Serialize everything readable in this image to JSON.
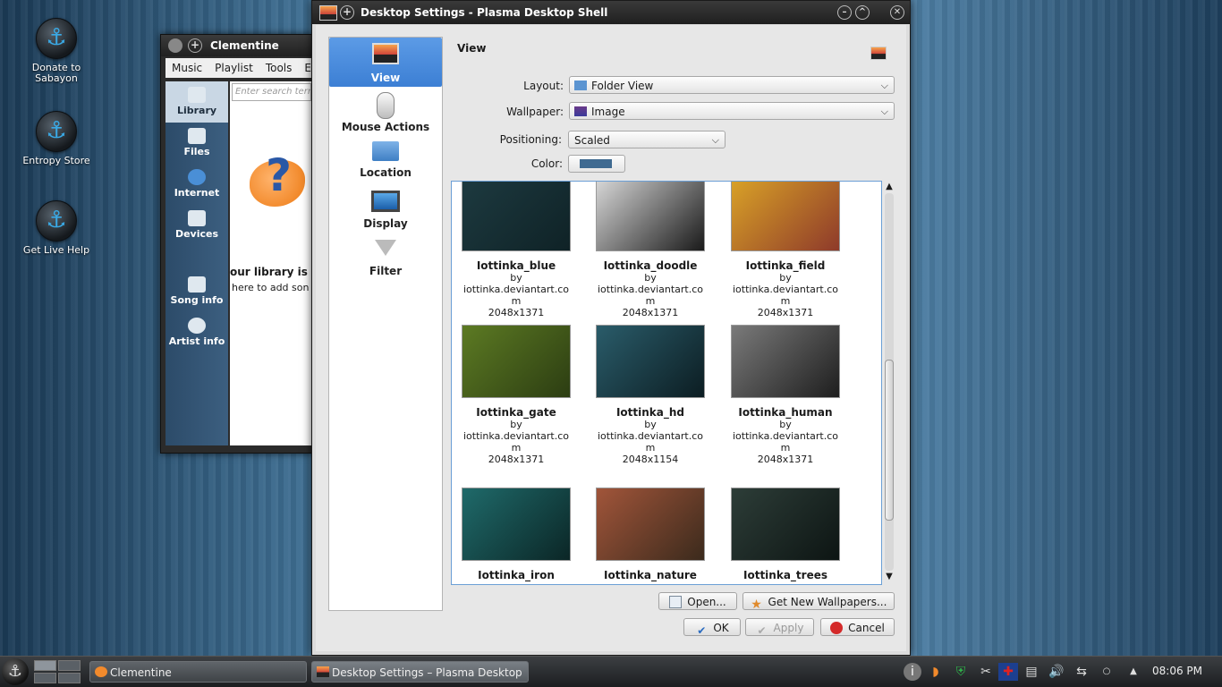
{
  "desktop": {
    "icons": [
      {
        "label_line1": "Donate to",
        "label_line2": "Sabayon"
      },
      {
        "label_line1": "Entropy Store",
        "label_line2": ""
      },
      {
        "label_line1": "Get Live Help",
        "label_line2": ""
      }
    ]
  },
  "clementine": {
    "title": "Clementine",
    "menu": [
      "Music",
      "Playlist",
      "Tools",
      "E"
    ],
    "sidebar": [
      "Library",
      "Files",
      "Internet",
      "Devices",
      "Song info",
      "Artist info"
    ],
    "search_placeholder": "Enter search terms",
    "empty_line1": "our library is en",
    "empty_line2": "here to add son"
  },
  "dialog": {
    "title": "Desktop Settings - Plasma Desktop Shell",
    "pages": [
      "View",
      "Mouse Actions",
      "Location",
      "Display",
      "Filter"
    ],
    "pane_title": "View",
    "layout_label": "Layout:",
    "layout_value": "Folder View",
    "wallpaper_label": "Wallpaper:",
    "wallpaper_value": "Image",
    "positioning_label": "Positioning:",
    "positioning_value": "Scaled",
    "color_label": "Color:",
    "color_value": "#3f6a91",
    "wallpapers": [
      {
        "name": "Iottinka_blue",
        "by": "by",
        "author": "iottinka.deviantart.co",
        "author2": "m",
        "size": "2048x1371",
        "colors": [
          "#1d3a40",
          "#0f2226"
        ]
      },
      {
        "name": "Iottinka_doodle",
        "by": "by",
        "author": "iottinka.deviantart.co",
        "author2": "m",
        "size": "2048x1371",
        "colors": [
          "#d8d8d8",
          "#1a1a1a"
        ]
      },
      {
        "name": "Iottinka_field",
        "by": "by",
        "author": "iottinka.deviantart.co",
        "author2": "m",
        "size": "2048x1371",
        "colors": [
          "#d9a227",
          "#8e3a2a"
        ]
      },
      {
        "name": "Iottinka_gate",
        "by": "by",
        "author": "iottinka.deviantart.co",
        "author2": "m",
        "size": "2048x1371",
        "colors": [
          "#5c7a23",
          "#2c3d12"
        ]
      },
      {
        "name": "Iottinka_hd",
        "by": "by",
        "author": "iottinka.deviantart.co",
        "author2": "m",
        "size": "2048x1154",
        "colors": [
          "#2a5c6a",
          "#0c1d22"
        ]
      },
      {
        "name": "Iottinka_human",
        "by": "by",
        "author": "iottinka.deviantart.co",
        "author2": "m",
        "size": "2048x1371",
        "colors": [
          "#7a7a7a",
          "#1e1e1e"
        ]
      },
      {
        "name": "Iottinka_iron",
        "by": "",
        "author": "",
        "author2": "",
        "size": "",
        "colors": [
          "#1f6a6a",
          "#0b2626"
        ]
      },
      {
        "name": "Iottinka_nature",
        "by": "",
        "author": "",
        "author2": "",
        "size": "",
        "colors": [
          "#a1553a",
          "#3b2a1c"
        ]
      },
      {
        "name": "Iottinka_trees",
        "by": "",
        "author": "",
        "author2": "",
        "size": "",
        "colors": [
          "#2d3d38",
          "#0d1513"
        ]
      }
    ],
    "open_label": "Open...",
    "get_new_label": "Get New Wallpapers...",
    "ok_label": "OK",
    "apply_label": "Apply",
    "cancel_label": "Cancel"
  },
  "taskbar": {
    "tasks": [
      "Clementine",
      "Desktop Settings – Plasma Desktop"
    ],
    "clock": "08:06 PM"
  }
}
